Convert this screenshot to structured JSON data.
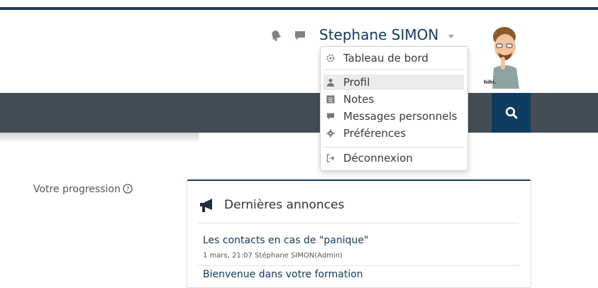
{
  "header": {
    "user_name": "Stephane SIMON",
    "icons": [
      "bell-icon",
      "message-icon",
      "chevron-down-icon"
    ]
  },
  "user_menu": {
    "items": [
      {
        "label": "Tableau de bord",
        "icon": "dashboard-icon"
      },
      {
        "label": "Profil",
        "icon": "user-icon",
        "active": true
      },
      {
        "label": "Notes",
        "icon": "grades-icon"
      },
      {
        "label": "Messages personnels",
        "icon": "message-icon"
      },
      {
        "label": "Préférences",
        "icon": "gear-icon"
      },
      {
        "label": "Déconnexion",
        "icon": "logout-icon"
      }
    ]
  },
  "avatar": {
    "caption": "hihi."
  },
  "navbar": {
    "search_icon": "search-icon"
  },
  "progress": {
    "label": "Votre progression"
  },
  "announcements": {
    "title": "Dernières annonces",
    "posts": [
      {
        "title": "Les contacts en cas de \"panique\"",
        "meta": "1 mars, 21:07  Stéphane SIMON(Admin)"
      },
      {
        "title": "Bienvenue dans votre formation",
        "meta": ""
      }
    ]
  },
  "colors": {
    "navbar": "#434d56",
    "search_button": "#0f3d62",
    "accent": "#0f3a5d"
  }
}
